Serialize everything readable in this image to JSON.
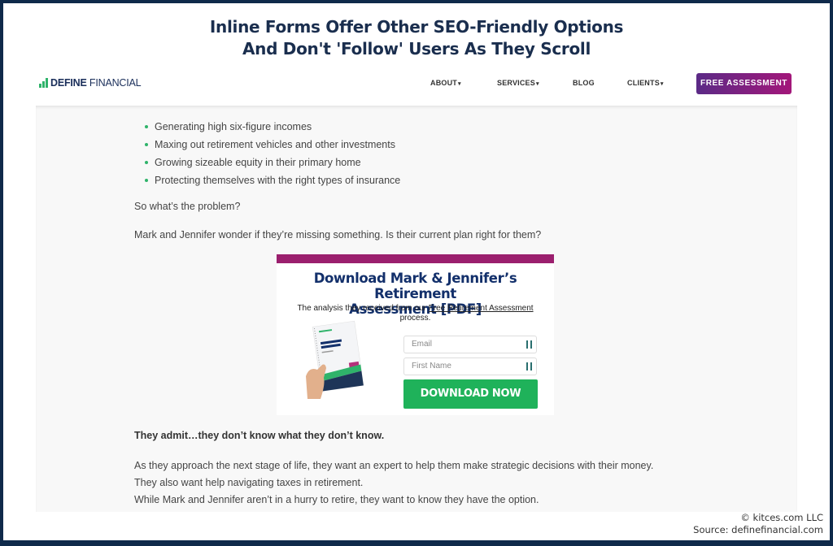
{
  "slide": {
    "title_line1": "Inline Forms Offer Other SEO-Friendly Options",
    "title_line2": "And Don't 'Follow' Users As They Scroll",
    "footer_copyright": "© kitces.com LLC",
    "footer_source": "Source: definefinancial.com"
  },
  "nav": {
    "logo_bold": "DEFINE",
    "logo_light": " FINANCIAL",
    "items": [
      {
        "label": "ABOUT",
        "has_dropdown": true
      },
      {
        "label": "SERVICES",
        "has_dropdown": true
      },
      {
        "label": "BLOG",
        "has_dropdown": false
      },
      {
        "label": "CLIENTS",
        "has_dropdown": true
      }
    ],
    "caret": "▾",
    "cta_label": "FREE ASSESSMENT"
  },
  "content": {
    "bullets": [
      "Generating high six-figure incomes",
      "Maxing out retirement vehicles and other investments",
      "Growing sizeable equity in their primary home",
      "Protecting themselves with the right types of insurance"
    ],
    "problem_question": "So what’s the problem?",
    "wonder_text": "Mark and Jennifer wonder if they’re missing something. Is their current plan right for them?",
    "admit_text": "They admit…they don’t know what they don’t know.",
    "closing_lines": [
      "As they approach the next stage of life, they want an expert to help them make strategic decisions with their money.",
      "They also want help navigating taxes in retirement.",
      "While Mark and Jennifer aren’t in a hurry to retire, they want to know they have the option."
    ]
  },
  "form": {
    "heading_line1": "Download Mark & Jennifer’s Retirement",
    "heading_line2": "Assessment [PDF]",
    "sub_prefix": "The analysis they received from our ",
    "sub_link": "Free Retirement Assessment",
    "sub_suffix": "process.",
    "book_title": "Retirement Assessment",
    "email_placeholder": "Email",
    "first_name_placeholder": "First Name",
    "button_label": "DOWNLOAD NOW"
  },
  "colors": {
    "frame": "#0f2a4a",
    "brand_green": "#2fb36a",
    "cta_purple": "#5b2a86",
    "cta_magenta": "#a3177a",
    "form_bar": "#9b1f6e",
    "download_green": "#1fb25a",
    "heading_navy": "#13306b"
  }
}
